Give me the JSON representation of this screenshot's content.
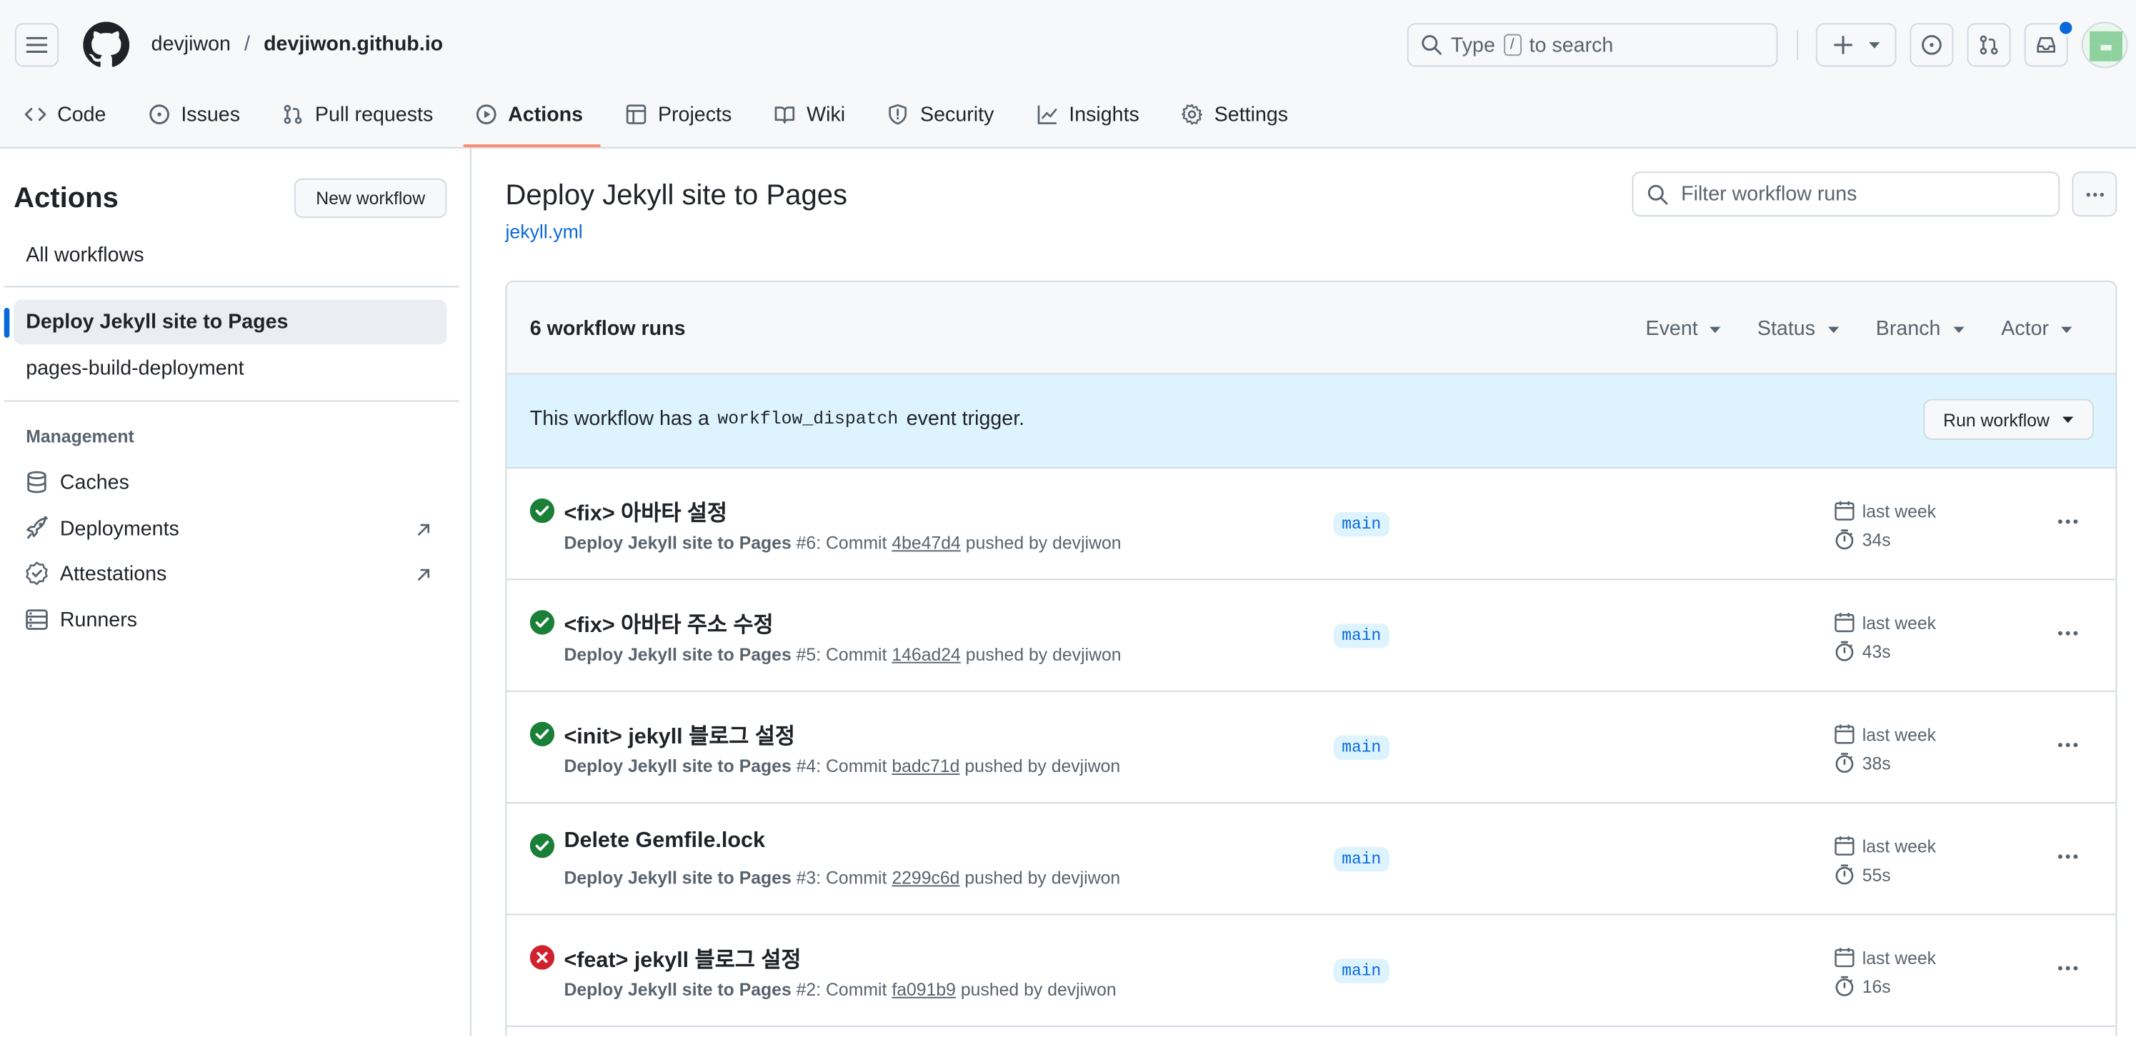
{
  "header": {
    "owner": "devjiwon",
    "separator": "/",
    "repo": "devjiwon.github.io",
    "search_prefix": "Type",
    "search_key": "/",
    "search_suffix": "to search"
  },
  "tabs": [
    {
      "label": "Code",
      "icon": "code-icon"
    },
    {
      "label": "Issues",
      "icon": "issue-icon"
    },
    {
      "label": "Pull requests",
      "icon": "pull-request-icon"
    },
    {
      "label": "Actions",
      "icon": "play-icon",
      "active": true
    },
    {
      "label": "Projects",
      "icon": "table-icon"
    },
    {
      "label": "Wiki",
      "icon": "book-icon"
    },
    {
      "label": "Security",
      "icon": "shield-icon"
    },
    {
      "label": "Insights",
      "icon": "graph-icon"
    },
    {
      "label": "Settings",
      "icon": "gear-icon"
    }
  ],
  "sidebar": {
    "title": "Actions",
    "new_workflow": "New workflow",
    "all_workflows": "All workflows",
    "workflows": [
      "Deploy Jekyll site to Pages",
      "pages-build-deployment"
    ],
    "management_label": "Management",
    "management": [
      {
        "label": "Caches",
        "icon": "database-icon"
      },
      {
        "label": "Deployments",
        "icon": "rocket-icon",
        "external": true
      },
      {
        "label": "Attestations",
        "icon": "verified-icon",
        "external": true
      },
      {
        "label": "Runners",
        "icon": "server-icon"
      }
    ]
  },
  "main": {
    "title": "Deploy Jekyll site to Pages",
    "file": "jekyll.yml",
    "filter_placeholder": "Filter workflow runs",
    "runs_count": "6 workflow runs",
    "filters": [
      "Event",
      "Status",
      "Branch",
      "Actor"
    ],
    "banner_prefix": "This workflow has a",
    "banner_code": "workflow_dispatch",
    "banner_suffix": "event trigger.",
    "run_workflow": "Run workflow"
  },
  "runs": [
    {
      "title": "<fix> 아바타 설정",
      "workflow": "Deploy Jekyll site to Pages",
      "number": "#6",
      "sha": "4be47d4",
      "actor": "devjiwon",
      "branch": "main",
      "when": "last week",
      "duration": "34s",
      "status": "success"
    },
    {
      "title": "<fix> 아바타 주소 수정",
      "workflow": "Deploy Jekyll site to Pages",
      "number": "#5",
      "sha": "146ad24",
      "actor": "devjiwon",
      "branch": "main",
      "when": "last week",
      "duration": "43s",
      "status": "success"
    },
    {
      "title": "<init> jekyll 블로그 설정",
      "workflow": "Deploy Jekyll site to Pages",
      "number": "#4",
      "sha": "badc71d",
      "actor": "devjiwon",
      "branch": "main",
      "when": "last week",
      "duration": "38s",
      "status": "success"
    },
    {
      "title": "Delete Gemfile.lock",
      "workflow": "Deploy Jekyll site to Pages",
      "number": "#3",
      "sha": "2299c6d",
      "actor": "devjiwon",
      "branch": "main",
      "when": "last week",
      "duration": "55s",
      "status": "success"
    },
    {
      "title": "<feat> jekyll 블로그 설정",
      "workflow": "Deploy Jekyll site to Pages",
      "number": "#2",
      "sha": "fa091b9",
      "actor": "devjiwon",
      "branch": "main",
      "when": "last week",
      "duration": "16s",
      "status": "failure"
    }
  ],
  "labels": {
    "commit": "Commit",
    "pushed_by": "pushed by"
  },
  "colors": {
    "accent": "#0969da",
    "success": "#1a7f37",
    "failure": "#cf222e",
    "tab_underline": "#fd8c73"
  }
}
